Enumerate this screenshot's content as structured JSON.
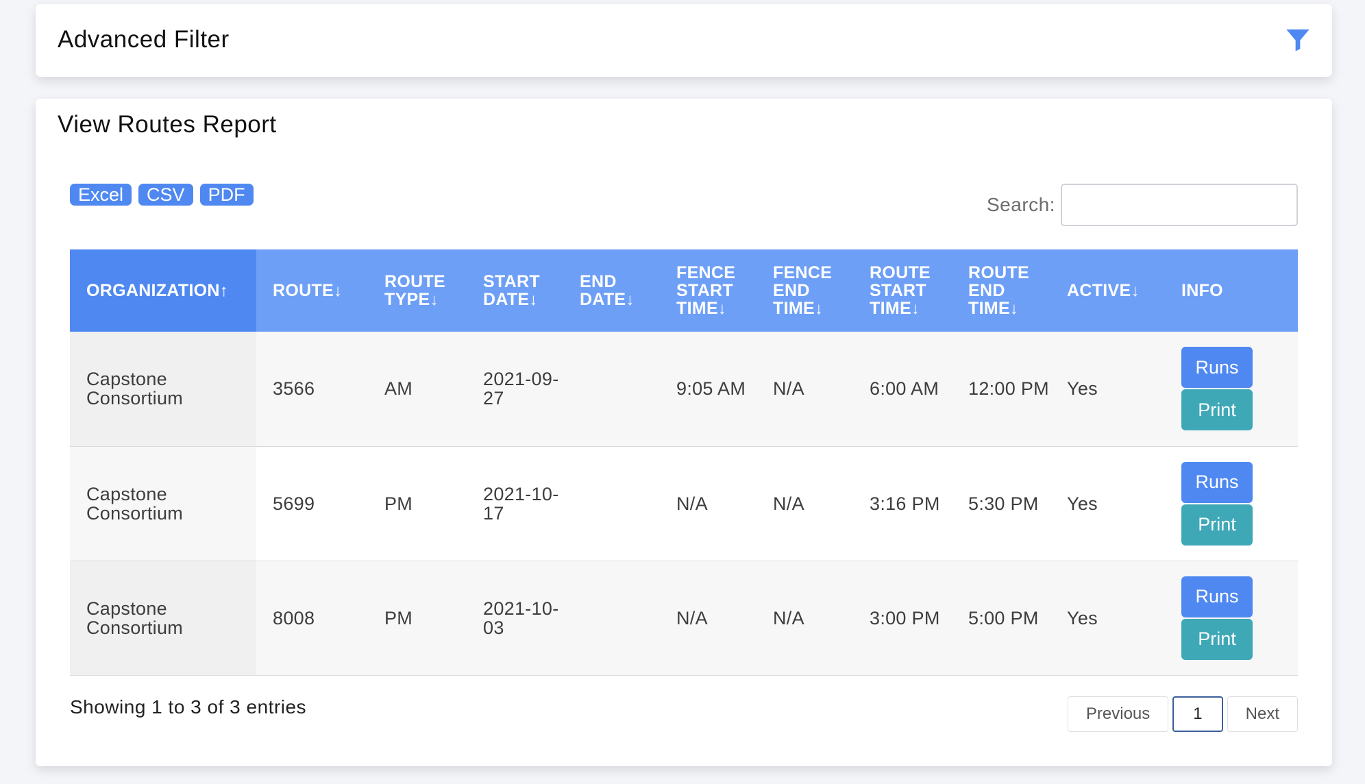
{
  "filter_panel": {
    "title": "Advanced Filter",
    "icon": "filter-icon",
    "icon_color": "#4f88f1"
  },
  "report": {
    "title": "View Routes Report",
    "export_buttons": [
      "Excel",
      "CSV",
      "PDF"
    ],
    "search": {
      "label": "Search:",
      "value": "",
      "placeholder": ""
    },
    "columns": {
      "organization": "ORGANIZATION",
      "route": "ROUTE",
      "route_type": "ROUTE TYPE",
      "start_date": "START DATE",
      "end_date": "END DATE",
      "fence_start_time": "FENCE START TIME",
      "fence_end_time": "FENCE END TIME",
      "route_start_time": "ROUTE START TIME",
      "route_end_time": "ROUTE END TIME",
      "active": "ACTIVE",
      "info": "INFO"
    },
    "sort_arrows": {
      "asc": "↑",
      "desc": "↓"
    },
    "rows": [
      {
        "organization": "Capstone Consortium",
        "route": "3566",
        "route_type": "AM",
        "start_date": "2021-09-27",
        "end_date": "",
        "fence_start_time": "9:05 AM",
        "fence_end_time": "N/A",
        "route_start_time": "6:00 AM",
        "route_end_time": "12:00 PM",
        "active": "Yes",
        "runs_label": "Runs",
        "print_label": "Print"
      },
      {
        "organization": "Capstone Consortium",
        "route": "5699",
        "route_type": "PM",
        "start_date": "2021-10-17",
        "end_date": "",
        "fence_start_time": "N/A",
        "fence_end_time": "N/A",
        "route_start_time": "3:16 PM",
        "route_end_time": "5:30 PM",
        "active": "Yes",
        "runs_label": "Runs",
        "print_label": "Print"
      },
      {
        "organization": "Capstone Consortium",
        "route": "8008",
        "route_type": "PM",
        "start_date": "2021-10-03",
        "end_date": "",
        "fence_start_time": "N/A",
        "fence_end_time": "N/A",
        "route_start_time": "3:00 PM",
        "route_end_time": "5:00 PM",
        "active": "Yes",
        "runs_label": "Runs",
        "print_label": "Print"
      }
    ],
    "info_text": "Showing 1 to 3 of 3 entries",
    "pagination": {
      "previous": "Previous",
      "current_page": "1",
      "next": "Next"
    },
    "colors": {
      "header": "#6d9ff6",
      "sorted_header": "#4f88f1",
      "runs_button": "#4f88f1",
      "print_button": "#3fa8b7"
    }
  }
}
